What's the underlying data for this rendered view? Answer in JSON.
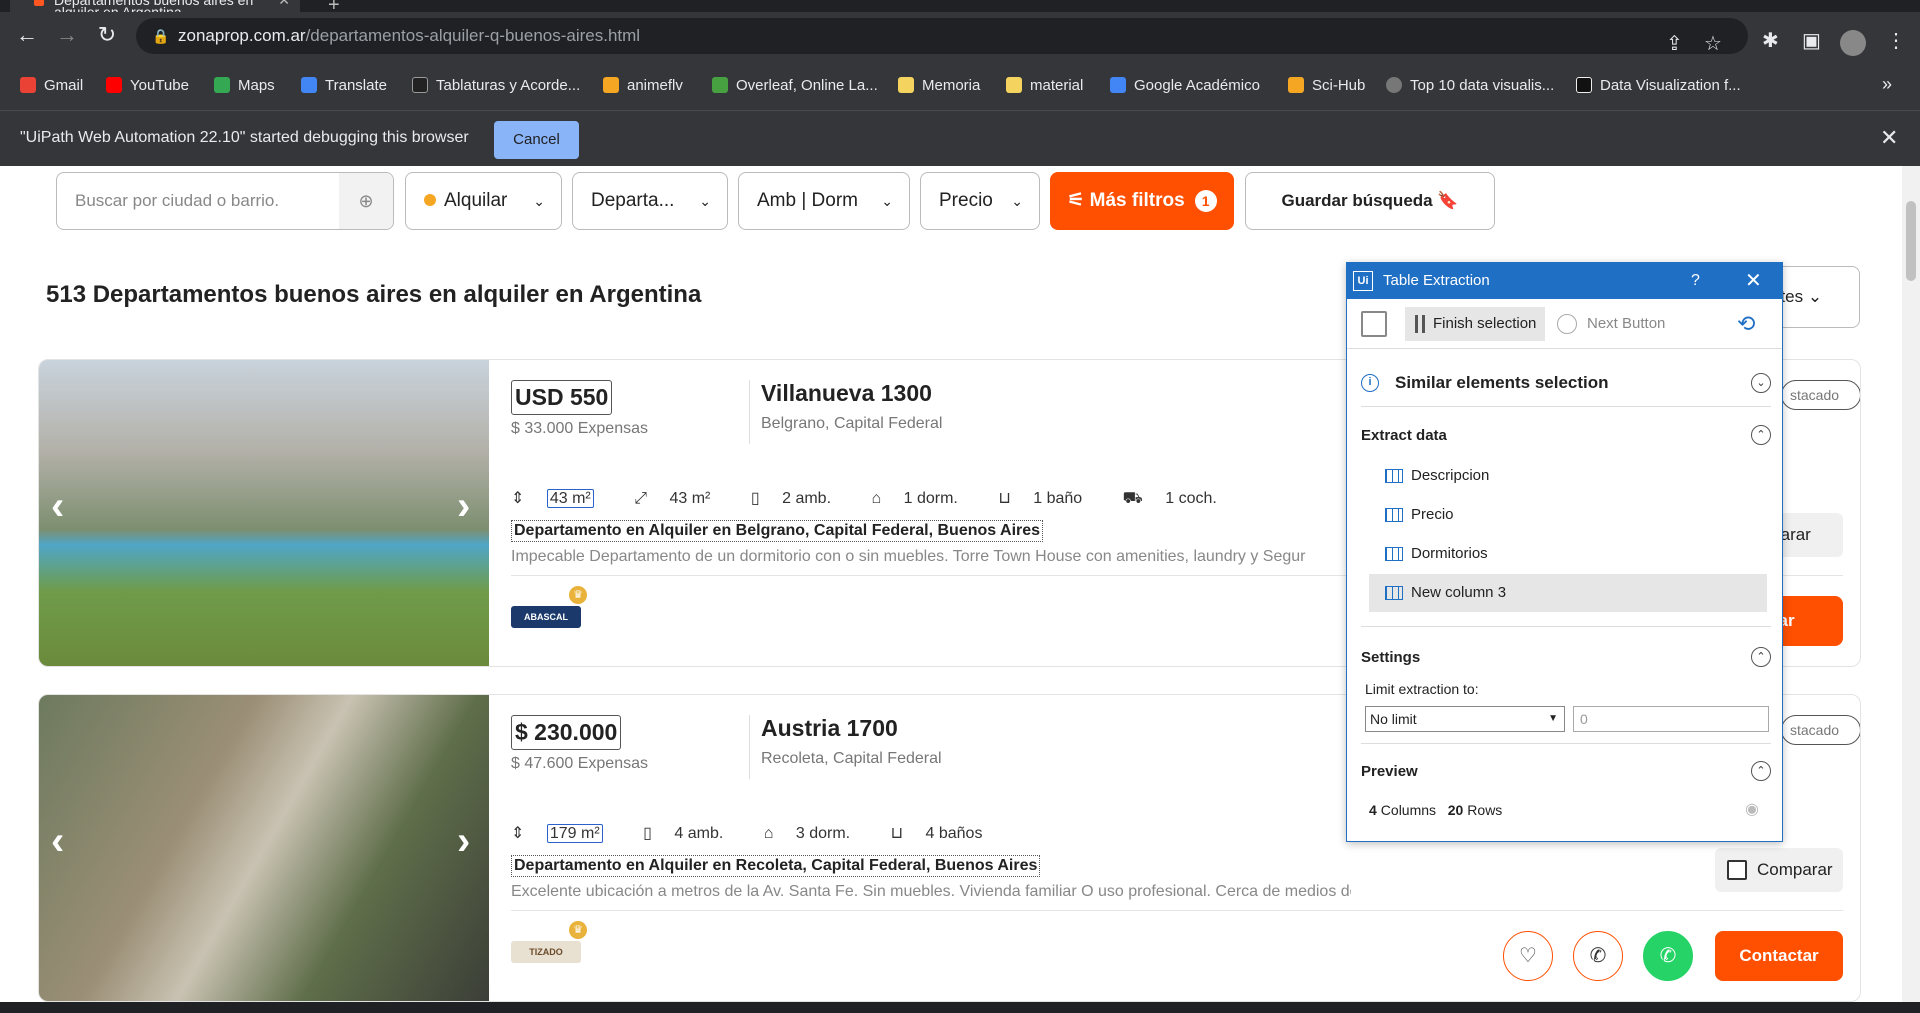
{
  "browser": {
    "tab_title": "Departamentos buenos aires en alquiler en Argentina",
    "url_domain": "zonaprop.com.ar",
    "url_path": "/departamentos-alquiler-q-buenos-aires.html",
    "bookmarks": [
      {
        "label": "Gmail",
        "color": "#ea4335"
      },
      {
        "label": "YouTube",
        "color": "#ff0000"
      },
      {
        "label": "Maps",
        "color": "#34a853"
      },
      {
        "label": "Translate",
        "color": "#4285f4"
      },
      {
        "label": "Tablaturas y Acorde...",
        "color": "#222222"
      },
      {
        "label": "animeflv",
        "color": "#f5a623"
      },
      {
        "label": "Overleaf, Online La...",
        "color": "#47a141"
      },
      {
        "label": "Memoria",
        "color": "#f4d35e"
      },
      {
        "label": "material",
        "color": "#f4d35e"
      },
      {
        "label": "Google Académico",
        "color": "#4285f4"
      },
      {
        "label": "Sci-Hub",
        "color": "#f5a623"
      },
      {
        "label": "Top 10 data visualis...",
        "color": "#777777"
      },
      {
        "label": "Data Visualization f...",
        "color": "#111111"
      }
    ]
  },
  "debug_bar": {
    "message": "\"UiPath Web Automation 22.10\" started debugging this browser",
    "cancel_label": "Cancel"
  },
  "filters": {
    "search_placeholder": "Buscar por ciudad o barrio.",
    "operation": "Alquilar",
    "property_type": "Departa...",
    "rooms": "Amb | Dorm",
    "price": "Precio",
    "more_filters": "Más filtros",
    "more_filters_count": "1",
    "save_search": "Guardar búsqueda"
  },
  "results_title": "513 Departamentos buenos aires en alquiler en Argentina",
  "sort_label": "ntes",
  "listings": [
    {
      "price": "USD 550",
      "expensas": "$ 33.000 Expensas",
      "address": "Villanueva 1300",
      "location": "Belgrano, Capital Federal",
      "features": [
        "43 m²",
        "43 m²",
        "2 amb.",
        "1 dorm.",
        "1 baño",
        "1 coch."
      ],
      "title": "Departamento en Alquiler en Belgrano, Capital Federal, Buenos Aires",
      "description": "Impecable Departamento de un dormitorio con o sin muebles. Torre Town House con amenities, laundry y Segur",
      "agency": "ABASCAL",
      "badge": "stacado",
      "compare": "mparar",
      "contact": "ctar"
    },
    {
      "price": "$ 230.000",
      "expensas": "$ 47.600 Expensas",
      "address": "Austria 1700",
      "location": "Recoleta, Capital Federal",
      "features": [
        "179 m²",
        "4 amb.",
        "3 dorm.",
        "4 baños"
      ],
      "title": "Departamento en Alquiler en Recoleta, Capital Federal, Buenos Aires",
      "description": "Excelente ubicación a metros de la Av. Santa Fe. Sin muebles. Vivienda familiar O uso profesional. Cerca de medios de transporte, Subte \"...",
      "agency": "TIZADO",
      "badge": "stacado",
      "compare": "Comparar",
      "contact": "Contactar"
    }
  ],
  "table_extraction": {
    "title": "Table Extraction",
    "help": "?",
    "finish_selection": "Finish selection",
    "next_button": "Next Button",
    "similar_elements": "Similar elements selection",
    "extract_data": "Extract data",
    "columns": [
      "Descripcion",
      "Precio",
      "Dormitorios",
      "New column 3"
    ],
    "settings": "Settings",
    "limit_label": "Limit extraction to:",
    "limit_value": "No limit",
    "limit_number": "0",
    "preview": "Preview",
    "preview_columns": "4",
    "preview_columns_label": "Columns",
    "preview_rows": "20",
    "preview_rows_label": "Rows"
  }
}
